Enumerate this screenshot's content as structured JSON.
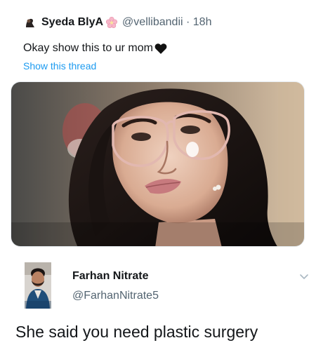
{
  "original_tweet": {
    "author_name": "Syeda BlyA",
    "handle_time": "@vellibandii · 18h",
    "text": "Okay show this to ur mom",
    "show_thread_label": "Show this thread",
    "icons": [
      "avatar-small",
      "flower-emoji-icon",
      "black-heart-icon"
    ],
    "colors": {
      "link": "#1d9bf0",
      "secondary_text": "#536471"
    }
  },
  "reply": {
    "author_name": "Farhan Nitrate",
    "handle": "@FarhanNitrate5",
    "text": "She said you need plastic surgery",
    "icons": [
      "avatar",
      "chevron-down-icon"
    ]
  }
}
